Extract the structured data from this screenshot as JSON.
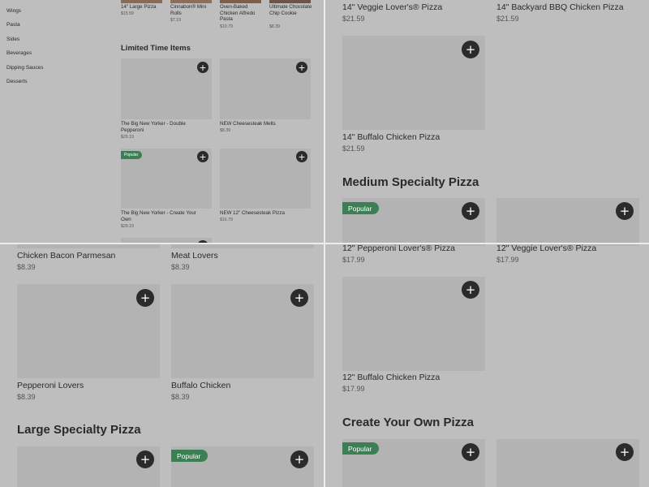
{
  "sidebar": {
    "items": [
      "Wings",
      "Pasta",
      "Sides",
      "Beverages",
      "Dipping Sauces",
      "Desserts"
    ]
  },
  "q1": {
    "top_items": [
      {
        "name": "14\" Large Pizza",
        "price": "$15.59"
      },
      {
        "name": "Cinnabon® Mini Rolls",
        "price": "$7.19"
      },
      {
        "name": "Oven-Baked Chicken Alfredo Pasta",
        "price": "$10.79"
      },
      {
        "name": "Ultimate Chocolate Chip Cookie",
        "price": "$8.39"
      }
    ],
    "section_title": "Limited Time Items",
    "items": [
      {
        "name": "The Big New Yorker - Double Pepperoni",
        "price": "$29.19"
      },
      {
        "name": "NEW Cheesesteak Melts",
        "price": "$8.39"
      },
      {
        "name": "The Big New Yorker - Create Your Own",
        "price": "$29.19",
        "badge": "Popular"
      },
      {
        "name": "NEW 12\" Cheesesteak Pizza",
        "price": "$16.79"
      }
    ]
  },
  "q2": {
    "items": [
      {
        "name": "14\" Veggie Lover's® Pizza",
        "price": "$21.59"
      },
      {
        "name": "14\" Backyard BBQ Chicken Pizza",
        "price": "$21.59"
      },
      {
        "name": "14\" Buffalo Chicken Pizza",
        "price": "$21.59"
      }
    ],
    "section_title": "Medium Specialty Pizza",
    "badge": "Popular"
  },
  "q3": {
    "items": [
      {
        "name": "Chicken Bacon Parmesan",
        "price": "$8.39"
      },
      {
        "name": "Meat Lovers",
        "price": "$8.39"
      },
      {
        "name": "Pepperoni Lovers",
        "price": "$8.39"
      },
      {
        "name": "Buffalo Chicken",
        "price": "$8.39"
      }
    ],
    "section_title": "Large Specialty Pizza",
    "badge": "Popular"
  },
  "q4": {
    "items": [
      {
        "name": "12\" Pepperoni Lover's® Pizza",
        "price": "$17.99"
      },
      {
        "name": "12\" Veggie Lover's® Pizza",
        "price": "$17.99"
      },
      {
        "name": "12\" Buffalo Chicken Pizza",
        "price": "$17.99"
      }
    ],
    "section_title": "Create Your Own Pizza",
    "badge": "Popular"
  },
  "icons": {
    "add": "+"
  },
  "colors": {
    "badge": "#3d7f55",
    "add_button": "#2b2b2b",
    "overlay": "#bebebe"
  }
}
